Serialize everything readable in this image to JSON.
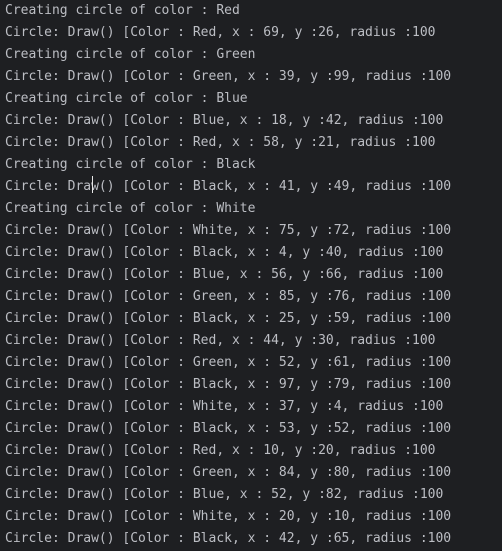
{
  "console": {
    "lines": [
      "Creating circle of color : Red",
      "Circle: Draw() [Color : Red, x : 69, y :26, radius :100",
      "Creating circle of color : Green",
      "Circle: Draw() [Color : Green, x : 39, y :99, radius :100",
      "Creating circle of color : Blue",
      "Circle: Draw() [Color : Blue, x : 18, y :42, radius :100",
      "Circle: Draw() [Color : Red, x : 58, y :21, radius :100",
      "Creating circle of color : Black",
      "Circle: Draw() [Color : Black, x : 41, y :49, radius :100",
      "Creating circle of color : White",
      "Circle: Draw() [Color : White, x : 75, y :72, radius :100",
      "Circle: Draw() [Color : Black, x : 4, y :40, radius :100",
      "Circle: Draw() [Color : Blue, x : 56, y :66, radius :100",
      "Circle: Draw() [Color : Green, x : 85, y :76, radius :100",
      "Circle: Draw() [Color : Black, x : 25, y :59, radius :100",
      "Circle: Draw() [Color : Red, x : 44, y :30, radius :100",
      "Circle: Draw() [Color : Green, x : 52, y :61, radius :100",
      "Circle: Draw() [Color : Black, x : 97, y :79, radius :100",
      "Circle: Draw() [Color : White, x : 37, y :4, radius :100",
      "Circle: Draw() [Color : Black, x : 53, y :52, radius :100",
      "Circle: Draw() [Color : Red, x : 10, y :20, radius :100",
      "Circle: Draw() [Color : Green, x : 84, y :80, radius :100",
      "Circle: Draw() [Color : Blue, x : 52, y :82, radius :100",
      "Circle: Draw() [Color : White, x : 20, y :10, radius :100",
      "Circle: Draw() [Color : Black, x : 42, y :65, radius :100"
    ]
  },
  "colors": {
    "background": "#1e1f22",
    "text": "#bcbec4",
    "caret": "#e8e8e8"
  }
}
